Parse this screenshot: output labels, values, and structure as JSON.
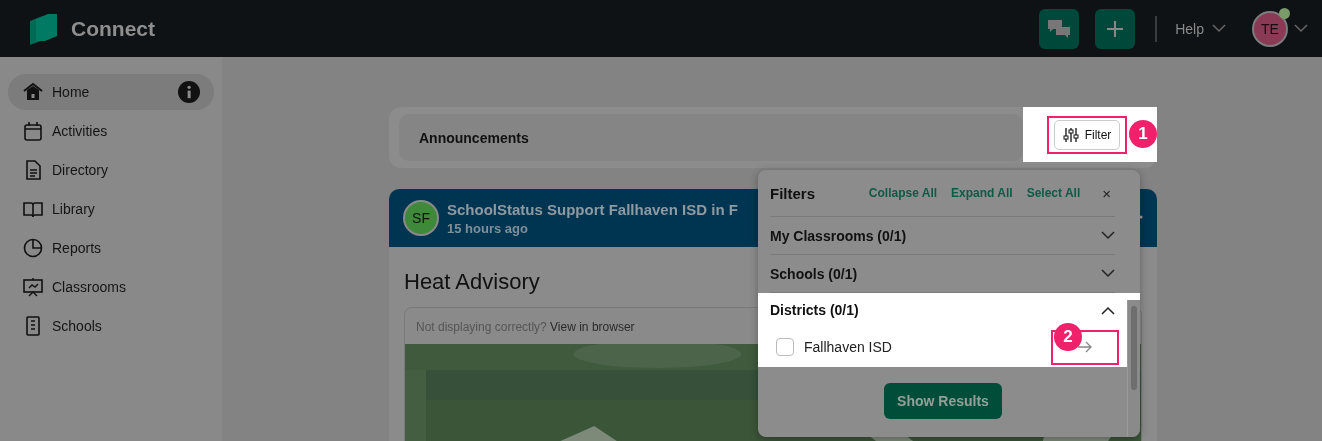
{
  "app": {
    "name": "Connect"
  },
  "header": {
    "help": "Help",
    "avatar": "TE",
    "online": true
  },
  "sidebar": {
    "items": [
      {
        "label": "Home",
        "selected": true
      },
      {
        "label": "Activities",
        "selected": false
      },
      {
        "label": "Directory",
        "selected": false
      },
      {
        "label": "Library",
        "selected": false
      },
      {
        "label": "Reports",
        "selected": false
      },
      {
        "label": "Classrooms",
        "selected": false
      },
      {
        "label": "Schools",
        "selected": false
      }
    ]
  },
  "announcements": {
    "title": "Announcements",
    "filter_button": "Filter",
    "callout": "1"
  },
  "post": {
    "avatar": "SF",
    "author": "SchoolStatus Support Fallhaven ISD",
    "in_text": "in F",
    "time": "15 hours ago",
    "title": "Heat Advisory",
    "email_notice": "Not displaying correctly?",
    "email_link": "View in browser"
  },
  "filters": {
    "title": "Filters",
    "actions": [
      "Collapse All",
      "Expand All",
      "Select All"
    ],
    "close": "×",
    "sections": [
      {
        "label": "My Classrooms (0/1)",
        "expanded": false,
        "highlighted": false
      },
      {
        "label": "Schools (0/1)",
        "expanded": false,
        "highlighted": false
      },
      {
        "label": "Districts (0/1)",
        "expanded": true,
        "highlighted": true,
        "options": [
          {
            "label": "Fallhaven ISD",
            "checked": false,
            "callout": "2"
          }
        ]
      }
    ],
    "submit": "Show Results"
  }
}
